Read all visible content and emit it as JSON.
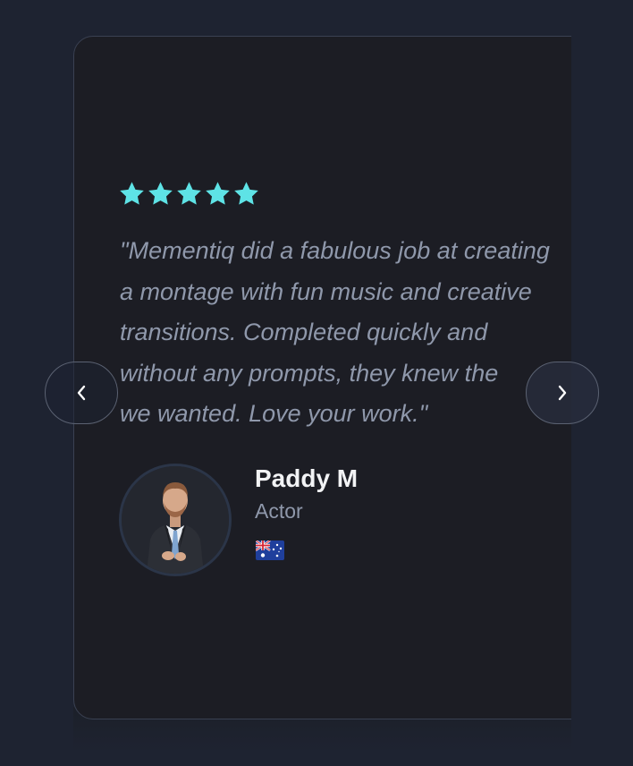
{
  "testimonial": {
    "rating": 5,
    "rating_max": 5,
    "star_color": "#5ee3e6",
    "quote_lines": [
      "\"Mementiq did a fabulous job at creating",
      "a montage with fun music and creative",
      "transitions. Completed quickly and",
      "without any prompts, they knew the",
      "we wanted. Love your work.\""
    ],
    "author": {
      "name": "Paddy M",
      "role": "Actor",
      "flag_icon": "australia-flag-icon",
      "avatar_icon": "person-avatar-photo"
    }
  },
  "carousel": {
    "prev_icon": "chevron-left-icon",
    "next_icon": "chevron-right-icon"
  },
  "colors": {
    "page_background": "#1e2331",
    "card_background": "#1c1d24",
    "card_border": "#3a4152",
    "quote_text": "#8f98ab",
    "name_text": "#f2f3f5"
  }
}
